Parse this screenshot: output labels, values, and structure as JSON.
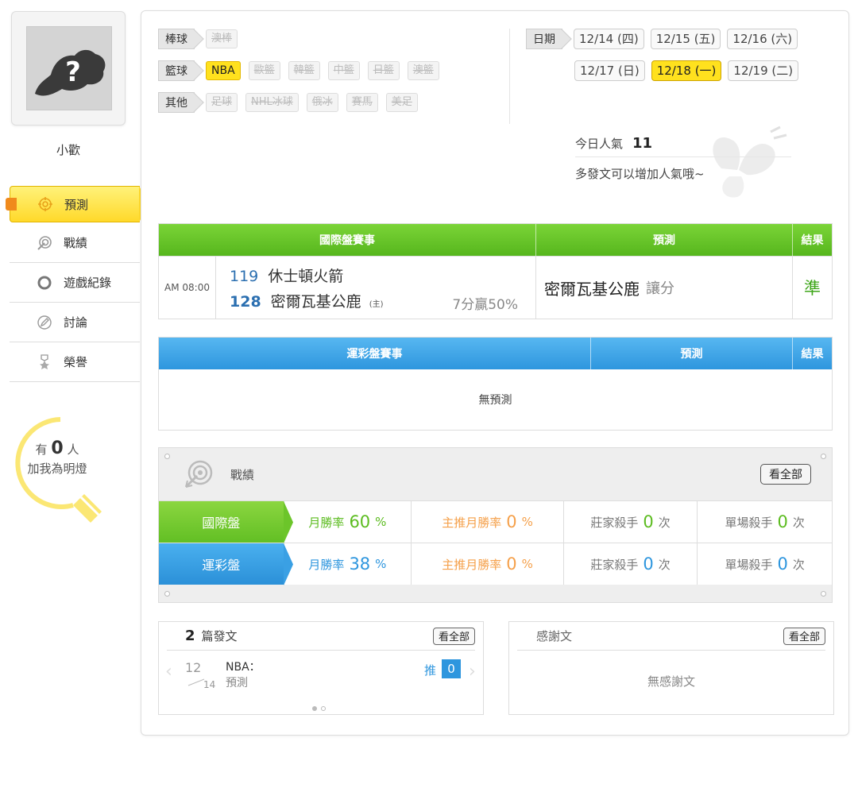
{
  "user": {
    "name": "小歡"
  },
  "sidebar": {
    "items": [
      {
        "label": "預測"
      },
      {
        "label": "戰績"
      },
      {
        "label": "遊戲紀錄"
      },
      {
        "label": "討論"
      },
      {
        "label": "榮譽"
      }
    ],
    "bulb": {
      "prefix": "有",
      "count": "0",
      "suffix": "人",
      "line2": "加我為明燈"
    }
  },
  "filters": {
    "baseball": {
      "label": "棒球",
      "options": [
        "澳棒"
      ]
    },
    "basketball": {
      "label": "籃球",
      "options": [
        "NBA",
        "歐籃",
        "韓籃",
        "中籃",
        "日籃",
        "澳籃"
      ],
      "selected": "NBA"
    },
    "other": {
      "label": "其他",
      "options": [
        "足球",
        "NHL冰球",
        "俄冰",
        "賽馬",
        "美足"
      ]
    }
  },
  "dates": {
    "label": "日期",
    "items": [
      "12/14 (四)",
      "12/15 (五)",
      "12/16 (六)",
      "12/17 (日)",
      "12/18 (一)",
      "12/19 (二)"
    ],
    "selected": "12/18 (一)"
  },
  "popularity": {
    "label": "今日人氣",
    "value": "11",
    "hint": "多發文可以增加人氣哦~"
  },
  "intl_table": {
    "headers": [
      "國際盤賽事",
      "預測",
      "結果"
    ],
    "rows": [
      {
        "time": "AM 08:00",
        "away_score": "119",
        "away_team": "休士頓火箭",
        "home_score": "128",
        "home_team": "密爾瓦基公鹿",
        "home_mark": "(主)",
        "odds": "7分贏50%",
        "pick_team": "密爾瓦基公鹿",
        "pick_type": "讓分",
        "result": "準"
      }
    ]
  },
  "lottery_table": {
    "headers": [
      "運彩盤賽事",
      "預測",
      "結果"
    ],
    "empty": "無預測"
  },
  "record": {
    "title": "戰績",
    "view_all": "看全部",
    "rows": [
      {
        "label": "國際盤",
        "month_label": "月勝率",
        "month_value": "60",
        "month_unit": "%",
        "main_label": "主推月勝率",
        "main_value": "0",
        "main_unit": "%",
        "banker_label": "莊家殺手",
        "banker_value": "0",
        "banker_unit": "次",
        "single_label": "單場殺手",
        "single_value": "0",
        "single_unit": "次"
      },
      {
        "label": "運彩盤",
        "month_label": "月勝率",
        "month_value": "38",
        "month_unit": "%",
        "main_label": "主推月勝率",
        "main_value": "0",
        "main_unit": "%",
        "banker_label": "莊家殺手",
        "banker_value": "0",
        "banker_unit": "次",
        "single_label": "單場殺手",
        "single_value": "0",
        "single_unit": "次"
      }
    ]
  },
  "posts": {
    "count": "2",
    "label": "篇發文",
    "view_all": "看全部",
    "item": {
      "month": "12",
      "day": "14",
      "category": "NBA：",
      "title": "預測",
      "push_label": "推",
      "push_count": "0"
    }
  },
  "thanks": {
    "title": "感謝文",
    "view_all": "看全部",
    "empty": "無感謝文"
  },
  "colors": {
    "green": "#5cbc20",
    "blue": "#2e96de",
    "yellow": "#ffe11e",
    "orange": "#f5a04a"
  }
}
